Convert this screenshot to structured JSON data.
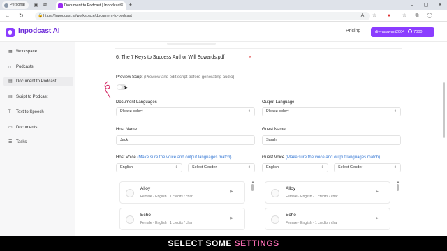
{
  "browser": {
    "profile_label": "Personal",
    "tab_title": "Document to Podcast | Inpodcast...",
    "url": "https://inpodcast.ai/workspace/document-to-podcast"
  },
  "header": {
    "brand": "Inpodcast AI",
    "pricing_label": "Pricing",
    "username": "divyaaswani2004",
    "credits": "7000"
  },
  "sidebar": {
    "items": [
      {
        "label": "Workspace",
        "icon": "grid-icon"
      },
      {
        "label": "Podcasts",
        "icon": "headphones-icon"
      },
      {
        "label": "Document to Podcast",
        "icon": "document-icon"
      },
      {
        "label": "Script to Podcast",
        "icon": "script-icon"
      },
      {
        "label": "Text to Speech",
        "icon": "speech-icon"
      },
      {
        "label": "Documents",
        "icon": "documents-icon"
      },
      {
        "label": "Tasks",
        "icon": "tasks-icon"
      }
    ]
  },
  "main": {
    "file_name": "6. The 7 Keys to Success Author Will Edwards.pdf",
    "preview_label": "Preview Script",
    "preview_hint": "(Preview and edit script before generating audio)",
    "doc_lang_label": "Document Languages",
    "doc_lang_value": "Please select",
    "out_lang_label": "Output Language",
    "out_lang_value": "Please select",
    "host_name_label": "Host Name",
    "host_name_value": "Jack",
    "guest_name_label": "Guest Name",
    "guest_name_value": "Sarah",
    "host_voice_label": "Host Voice",
    "guest_voice_label": "Guest Voice",
    "voice_hint": "(Make sure the voice and output languages match)",
    "host_lang_value": "English",
    "host_gender_value": "Select Gender",
    "guest_lang_value": "English",
    "guest_gender_value": "Select Gender",
    "voices": [
      {
        "name": "Alloy",
        "desc": "Female · English · 1 credits / char"
      },
      {
        "name": "Echo",
        "desc": "Female · English · 1 credits / char"
      }
    ]
  },
  "caption": {
    "part1": "SELECT SOME",
    "part2": "SETTINGS",
    "highlight_color": "#f56bb0"
  }
}
